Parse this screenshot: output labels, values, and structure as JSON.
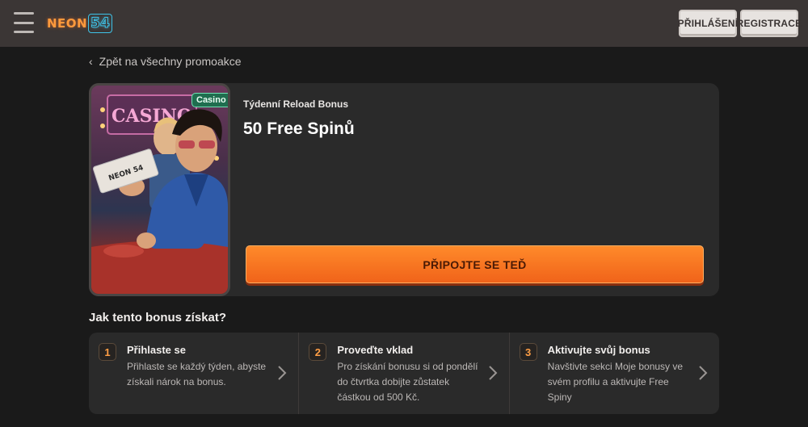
{
  "header": {
    "logo_text": "NEON",
    "logo_number": "54",
    "login_label": "PŘIHLÁŠENÍ",
    "register_label": "REGISTRACE"
  },
  "back_link": "Zpět na všechny promoakce",
  "promo": {
    "badge": "Casino",
    "subtitle": "Týdenní Reload Bonus",
    "title": "50 Free Spinů",
    "cta_label": "PŘIPOJTE SE TEĎ",
    "image_sign_text": "CASINO",
    "image_ticket_text": "NEON 54"
  },
  "how_to": {
    "title": "Jak tento bonus získat?",
    "steps": [
      {
        "number": "1",
        "title": "Přihlaste se",
        "description": "Přihlaste se každý týden, abyste získali nárok na bonus."
      },
      {
        "number": "2",
        "title": "Proveďte vklad",
        "description": "Pro získání bonusu si od pondělí do čtvrtka dobijte zůstatek částkou od 500 Kč."
      },
      {
        "number": "3",
        "title": "Aktivujte svůj bonus",
        "description": "Navštivte sekci Moje bonusy ve svém profilu a aktivujte Free Spiny"
      }
    ]
  },
  "colors": {
    "accent_orange": "#f0631a",
    "header_bg": "#3b3635",
    "page_bg": "#1a1a1a",
    "card_bg": "#2a2a2a",
    "badge_green": "#1f6e4f"
  }
}
